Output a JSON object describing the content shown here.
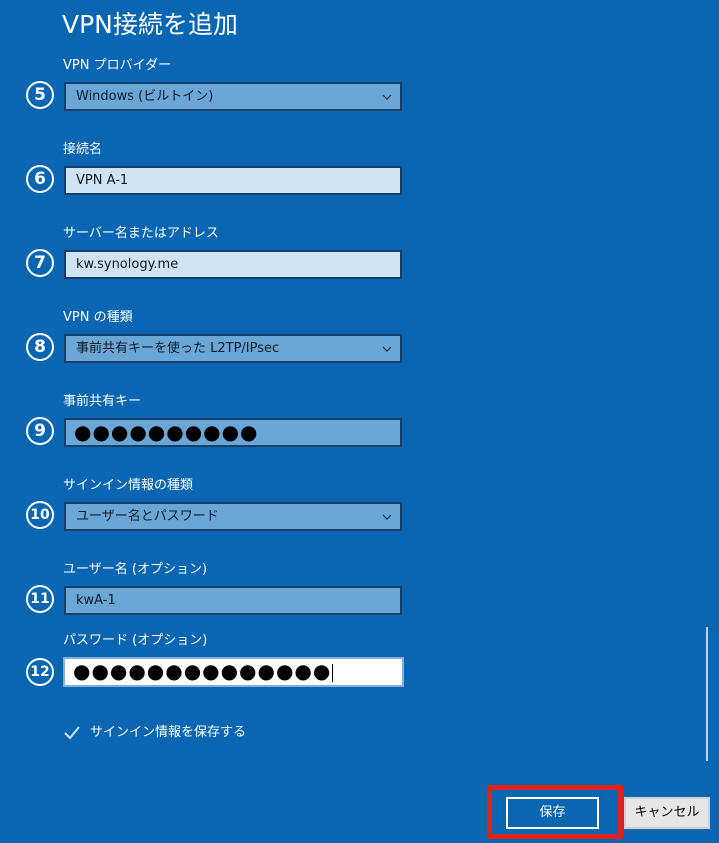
{
  "dialog": {
    "title": "VPN接続を追加"
  },
  "fields": {
    "provider": {
      "number": "5",
      "label": "VPN プロバイダー",
      "value": "Windows (ビルトイン)"
    },
    "connection_name": {
      "number": "6",
      "label": "接続名",
      "value": "VPN A-1"
    },
    "server": {
      "number": "7",
      "label": "サーバー名またはアドレス",
      "value": "kw.synology.me"
    },
    "vpn_type": {
      "number": "8",
      "label": "VPN の種類",
      "value": "事前共有キーを使った L2TP/IPsec"
    },
    "psk": {
      "number": "9",
      "label": "事前共有キー",
      "value": "●●●●●●●●●●"
    },
    "signin_type": {
      "number": "10",
      "label": "サインイン情報の種類",
      "value": "ユーザー名とパスワード"
    },
    "username": {
      "number": "11",
      "label": "ユーザー名 (オプション)",
      "value": "kwA-1"
    },
    "password": {
      "number": "12",
      "label": "パスワード (オプション)",
      "value": "●●●●●●●●●●●●●●"
    }
  },
  "remember": {
    "label": "サインイン情報を保存する",
    "checked": true
  },
  "buttons": {
    "save_label": "保存",
    "cancel_label": "キャンセル"
  },
  "colors": {
    "background": "#0a66b2",
    "highlight": "#e0201b"
  }
}
